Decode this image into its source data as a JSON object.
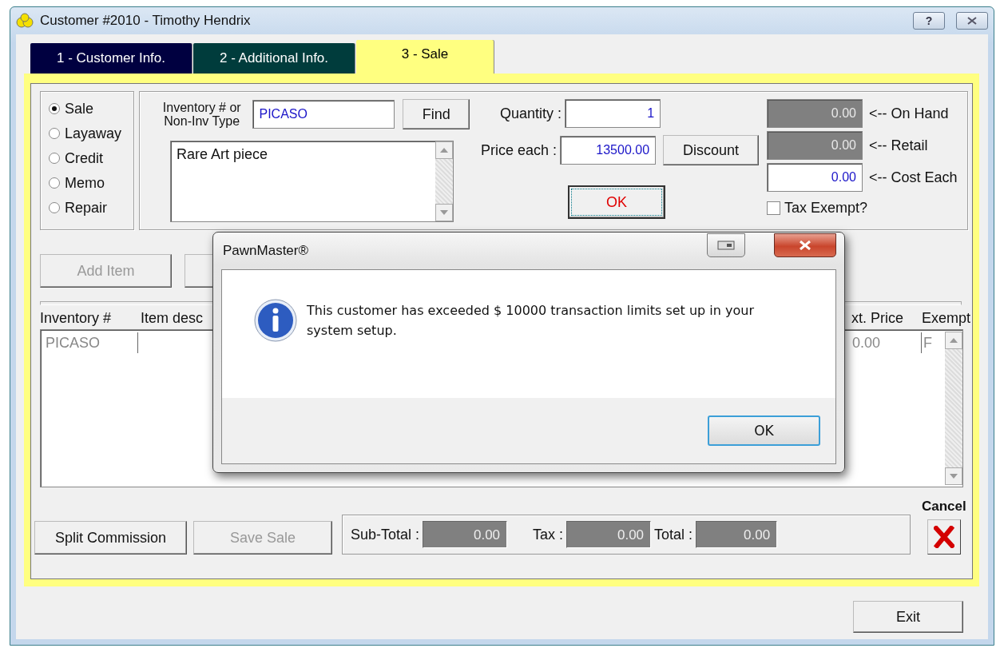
{
  "window": {
    "title": "Customer #2010 - Timothy Hendrix",
    "help_button": "?"
  },
  "tabs": [
    {
      "label": "1 - Customer Info.",
      "selected": false,
      "color": "#000040"
    },
    {
      "label": "2 - Additional Info.",
      "selected": false,
      "color": "#003c3c"
    },
    {
      "label": "3 - Sale",
      "selected": true,
      "color": "#ffff80"
    }
  ],
  "transaction_types": [
    {
      "label": "Sale",
      "selected": true
    },
    {
      "label": "Layaway",
      "selected": false
    },
    {
      "label": "Credit",
      "selected": false
    },
    {
      "label": "Memo",
      "selected": false
    },
    {
      "label": "Repair",
      "selected": false
    }
  ],
  "inventory": {
    "label": "Inventory # or Non-Inv Type",
    "value": "PICASO",
    "find_button": "Find"
  },
  "description": "Rare Art piece",
  "quantity": {
    "label": "Quantity :",
    "value": "1"
  },
  "price": {
    "label": "Price each :",
    "value": "13500.00"
  },
  "discount_button": "Discount",
  "ok_button": "OK",
  "summary": [
    {
      "value": "0.00",
      "label": "<-- On Hand",
      "kind": "readonly"
    },
    {
      "value": "0.00",
      "label": "<-- Retail",
      "kind": "readonly"
    },
    {
      "value": "0.00",
      "label": "<-- Cost Each",
      "kind": "editable"
    }
  ],
  "tax_exempt": {
    "label": "Tax Exempt?",
    "checked": false
  },
  "item_buttons": [
    {
      "label": "Add Item",
      "disabled": true
    }
  ],
  "items_list": {
    "columns": [
      "Inventory #",
      "Item desc",
      "xt. Price",
      "Exempt"
    ],
    "rows": [
      {
        "inventory": "PICASO",
        "ext_price": "0.00",
        "exempt": "F"
      }
    ]
  },
  "bottom_buttons": [
    {
      "label": "Split Commission",
      "disabled": false
    },
    {
      "label": "Save Sale",
      "disabled": true
    }
  ],
  "totals": [
    {
      "label": "Sub-Total :",
      "value": "0.00"
    },
    {
      "label": "Tax :",
      "value": "0.00"
    },
    {
      "label": "Total :",
      "value": "0.00"
    }
  ],
  "cancel": {
    "label": "Cancel"
  },
  "exit_button": "Exit",
  "dialog": {
    "title": "PawnMaster®",
    "message": "This customer has exceeded $ 10000 transaction limits set up in your system setup.",
    "ok_button": "OK"
  }
}
